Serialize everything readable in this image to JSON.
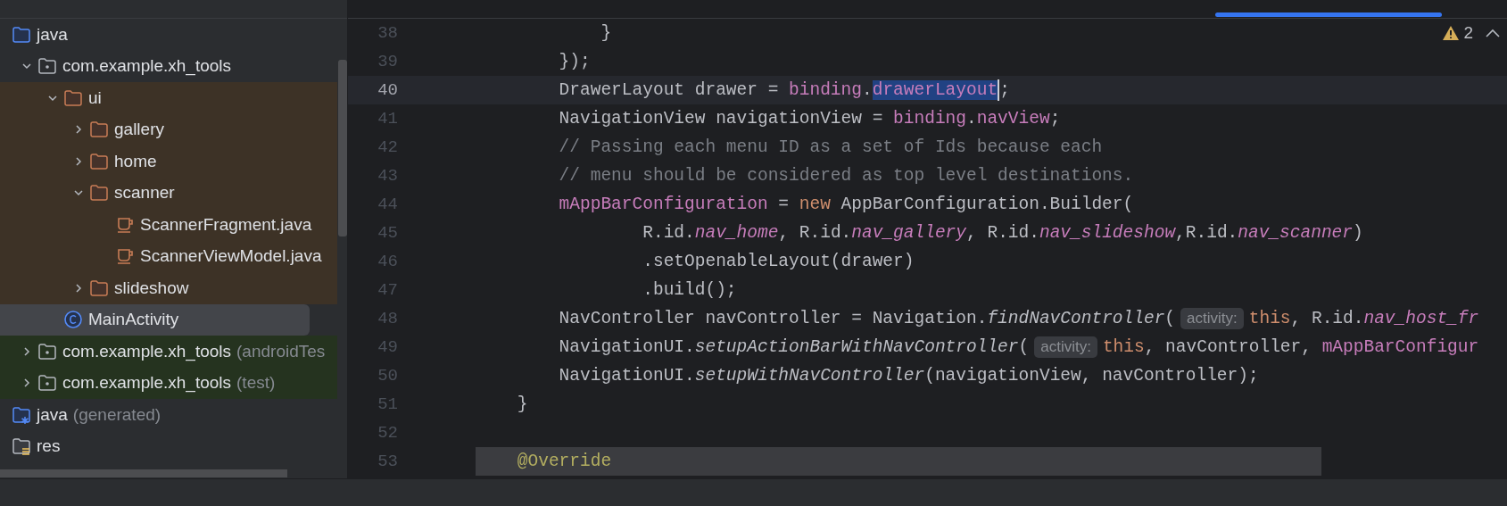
{
  "project_tree": {
    "items": [
      {
        "label": "java",
        "kind": "source_folder",
        "selected": false,
        "children": [
          {
            "label": "com.example.xh_tools",
            "kind": "package",
            "expanded": true,
            "selected": false,
            "children": [
              {
                "label": "ui",
                "kind": "folder",
                "expanded": true,
                "selected": false,
                "color": "#3d3226",
                "children": [
                  {
                    "label": "gallery",
                    "kind": "folder",
                    "expanded": false,
                    "selected": false,
                    "color": "#3d3226"
                  },
                  {
                    "label": "home",
                    "kind": "folder",
                    "expanded": false,
                    "selected": false,
                    "color": "#3d3226"
                  },
                  {
                    "label": "scanner",
                    "kind": "folder",
                    "expanded": true,
                    "selected": false,
                    "color": "#3d3226",
                    "children": [
                      {
                        "label": "ScannerFragment.java",
                        "kind": "java_file",
                        "selected": false,
                        "color": "#3d3226"
                      },
                      {
                        "label": "ScannerViewModel.java",
                        "kind": "java_file",
                        "selected": false,
                        "color": "#3d3226"
                      }
                    ]
                  },
                  {
                    "label": "slideshow",
                    "kind": "folder",
                    "expanded": false,
                    "selected": false,
                    "color": "#3d3226"
                  }
                ]
              },
              {
                "label": "MainActivity",
                "kind": "class",
                "selected": true
              }
            ]
          },
          {
            "label": "com.example.xh_tools",
            "suffix": "(androidTes",
            "kind": "package",
            "expanded": false,
            "selected": false,
            "color": "#25331f"
          },
          {
            "label": "com.example.xh_tools",
            "suffix": "(test)",
            "kind": "package",
            "expanded": false,
            "selected": false,
            "color": "#25331f"
          }
        ]
      },
      {
        "label": "java",
        "suffix": "(generated)",
        "kind": "generated_folder",
        "selected": false
      },
      {
        "label": "res",
        "kind": "resource_folder",
        "selected": false
      }
    ]
  },
  "editor": {
    "warnings": "2",
    "lines": [
      {
        "number": "38",
        "current": false,
        "highlighted": false,
        "tokens": [
          {
            "kind": "plain",
            "text": "            }"
          }
        ]
      },
      {
        "number": "39",
        "current": false,
        "highlighted": false,
        "tokens": [
          {
            "kind": "plain",
            "text": "        });"
          }
        ]
      },
      {
        "number": "40",
        "current": true,
        "highlighted": false,
        "tokens": [
          {
            "kind": "plain",
            "text": "        DrawerLayout drawer = "
          },
          {
            "kind": "field",
            "text": "binding"
          },
          {
            "kind": "plain",
            "text": "."
          },
          {
            "kind": "selected_field",
            "text": "drawerLayout"
          },
          {
            "kind": "caret"
          },
          {
            "kind": "plain",
            "text": ";"
          }
        ]
      },
      {
        "number": "41",
        "current": false,
        "highlighted": false,
        "tokens": [
          {
            "kind": "plain",
            "text": "        NavigationView navigationView = "
          },
          {
            "kind": "field",
            "text": "binding"
          },
          {
            "kind": "plain",
            "text": "."
          },
          {
            "kind": "field",
            "text": "navView"
          },
          {
            "kind": "plain",
            "text": ";"
          }
        ]
      },
      {
        "number": "42",
        "current": false,
        "highlighted": false,
        "tokens": [
          {
            "kind": "comment",
            "text": "        // Passing each menu ID as a set of Ids because each"
          }
        ]
      },
      {
        "number": "43",
        "current": false,
        "highlighted": false,
        "tokens": [
          {
            "kind": "comment",
            "text": "        // menu should be considered as top level destinations."
          }
        ]
      },
      {
        "number": "44",
        "current": false,
        "highlighted": false,
        "tokens": [
          {
            "kind": "field",
            "text": "        mAppBarConfiguration"
          },
          {
            "kind": "plain",
            "text": " = "
          },
          {
            "kind": "keyword",
            "text": "new"
          },
          {
            "kind": "plain",
            "text": " AppBarConfiguration.Builder("
          }
        ]
      },
      {
        "number": "45",
        "current": false,
        "highlighted": false,
        "tokens": [
          {
            "kind": "plain",
            "text": "                R.id."
          },
          {
            "kind": "static",
            "text": "nav_home"
          },
          {
            "kind": "plain",
            "text": ", R.id."
          },
          {
            "kind": "static",
            "text": "nav_gallery"
          },
          {
            "kind": "plain",
            "text": ", R.id."
          },
          {
            "kind": "static",
            "text": "nav_slideshow"
          },
          {
            "kind": "plain",
            "text": ",R.id."
          },
          {
            "kind": "static",
            "text": "nav_scanner"
          },
          {
            "kind": "plain",
            "text": ")"
          }
        ]
      },
      {
        "number": "46",
        "current": false,
        "highlighted": false,
        "tokens": [
          {
            "kind": "plain",
            "text": "                .setOpenableLayout(drawer)"
          }
        ]
      },
      {
        "number": "47",
        "current": false,
        "highlighted": false,
        "tokens": [
          {
            "kind": "plain",
            "text": "                .build();"
          }
        ]
      },
      {
        "number": "48",
        "current": false,
        "highlighted": false,
        "tokens": [
          {
            "kind": "plain",
            "text": "        NavController navController = Navigation."
          },
          {
            "kind": "method",
            "text": "findNavController"
          },
          {
            "kind": "plain",
            "text": "("
          },
          {
            "kind": "hint",
            "text": "activity:"
          },
          {
            "kind": "keyword",
            "text": "this"
          },
          {
            "kind": "plain",
            "text": ", R.id."
          },
          {
            "kind": "static",
            "text": "nav_host_fr"
          }
        ]
      },
      {
        "number": "49",
        "current": false,
        "highlighted": false,
        "tokens": [
          {
            "kind": "plain",
            "text": "        NavigationUI."
          },
          {
            "kind": "method",
            "text": "setupActionBarWithNavController"
          },
          {
            "kind": "plain",
            "text": "("
          },
          {
            "kind": "hint",
            "text": "activity:"
          },
          {
            "kind": "keyword",
            "text": "this"
          },
          {
            "kind": "plain",
            "text": ", navController, "
          },
          {
            "kind": "field",
            "text": "mAppBarConfigur"
          }
        ]
      },
      {
        "number": "50",
        "current": false,
        "highlighted": false,
        "tokens": [
          {
            "kind": "plain",
            "text": "        NavigationUI."
          },
          {
            "kind": "method",
            "text": "setupWithNavController"
          },
          {
            "kind": "plain",
            "text": "(navigationView, navController);"
          }
        ]
      },
      {
        "number": "51",
        "current": false,
        "highlighted": false,
        "tokens": [
          {
            "kind": "plain",
            "text": "    }"
          }
        ]
      },
      {
        "number": "52",
        "current": false,
        "highlighted": false
      },
      {
        "number": "53",
        "current": false,
        "highlighted": true,
        "tokens": [
          {
            "kind": "annotation",
            "text": "    @Override"
          }
        ]
      }
    ]
  }
}
